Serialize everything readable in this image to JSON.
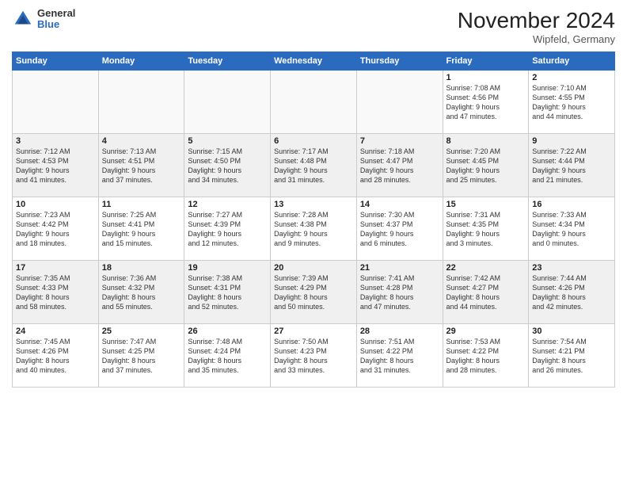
{
  "header": {
    "logo_general": "General",
    "logo_blue": "Blue",
    "title": "November 2024",
    "location": "Wipfeld, Germany"
  },
  "columns": [
    "Sunday",
    "Monday",
    "Tuesday",
    "Wednesday",
    "Thursday",
    "Friday",
    "Saturday"
  ],
  "weeks": [
    [
      {
        "day": "",
        "detail": ""
      },
      {
        "day": "",
        "detail": ""
      },
      {
        "day": "",
        "detail": ""
      },
      {
        "day": "",
        "detail": ""
      },
      {
        "day": "",
        "detail": ""
      },
      {
        "day": "1",
        "detail": "Sunrise: 7:08 AM\nSunset: 4:56 PM\nDaylight: 9 hours\nand 47 minutes."
      },
      {
        "day": "2",
        "detail": "Sunrise: 7:10 AM\nSunset: 4:55 PM\nDaylight: 9 hours\nand 44 minutes."
      }
    ],
    [
      {
        "day": "3",
        "detail": "Sunrise: 7:12 AM\nSunset: 4:53 PM\nDaylight: 9 hours\nand 41 minutes."
      },
      {
        "day": "4",
        "detail": "Sunrise: 7:13 AM\nSunset: 4:51 PM\nDaylight: 9 hours\nand 37 minutes."
      },
      {
        "day": "5",
        "detail": "Sunrise: 7:15 AM\nSunset: 4:50 PM\nDaylight: 9 hours\nand 34 minutes."
      },
      {
        "day": "6",
        "detail": "Sunrise: 7:17 AM\nSunset: 4:48 PM\nDaylight: 9 hours\nand 31 minutes."
      },
      {
        "day": "7",
        "detail": "Sunrise: 7:18 AM\nSunset: 4:47 PM\nDaylight: 9 hours\nand 28 minutes."
      },
      {
        "day": "8",
        "detail": "Sunrise: 7:20 AM\nSunset: 4:45 PM\nDaylight: 9 hours\nand 25 minutes."
      },
      {
        "day": "9",
        "detail": "Sunrise: 7:22 AM\nSunset: 4:44 PM\nDaylight: 9 hours\nand 21 minutes."
      }
    ],
    [
      {
        "day": "10",
        "detail": "Sunrise: 7:23 AM\nSunset: 4:42 PM\nDaylight: 9 hours\nand 18 minutes."
      },
      {
        "day": "11",
        "detail": "Sunrise: 7:25 AM\nSunset: 4:41 PM\nDaylight: 9 hours\nand 15 minutes."
      },
      {
        "day": "12",
        "detail": "Sunrise: 7:27 AM\nSunset: 4:39 PM\nDaylight: 9 hours\nand 12 minutes."
      },
      {
        "day": "13",
        "detail": "Sunrise: 7:28 AM\nSunset: 4:38 PM\nDaylight: 9 hours\nand 9 minutes."
      },
      {
        "day": "14",
        "detail": "Sunrise: 7:30 AM\nSunset: 4:37 PM\nDaylight: 9 hours\nand 6 minutes."
      },
      {
        "day": "15",
        "detail": "Sunrise: 7:31 AM\nSunset: 4:35 PM\nDaylight: 9 hours\nand 3 minutes."
      },
      {
        "day": "16",
        "detail": "Sunrise: 7:33 AM\nSunset: 4:34 PM\nDaylight: 9 hours\nand 0 minutes."
      }
    ],
    [
      {
        "day": "17",
        "detail": "Sunrise: 7:35 AM\nSunset: 4:33 PM\nDaylight: 8 hours\nand 58 minutes."
      },
      {
        "day": "18",
        "detail": "Sunrise: 7:36 AM\nSunset: 4:32 PM\nDaylight: 8 hours\nand 55 minutes."
      },
      {
        "day": "19",
        "detail": "Sunrise: 7:38 AM\nSunset: 4:31 PM\nDaylight: 8 hours\nand 52 minutes."
      },
      {
        "day": "20",
        "detail": "Sunrise: 7:39 AM\nSunset: 4:29 PM\nDaylight: 8 hours\nand 50 minutes."
      },
      {
        "day": "21",
        "detail": "Sunrise: 7:41 AM\nSunset: 4:28 PM\nDaylight: 8 hours\nand 47 minutes."
      },
      {
        "day": "22",
        "detail": "Sunrise: 7:42 AM\nSunset: 4:27 PM\nDaylight: 8 hours\nand 44 minutes."
      },
      {
        "day": "23",
        "detail": "Sunrise: 7:44 AM\nSunset: 4:26 PM\nDaylight: 8 hours\nand 42 minutes."
      }
    ],
    [
      {
        "day": "24",
        "detail": "Sunrise: 7:45 AM\nSunset: 4:26 PM\nDaylight: 8 hours\nand 40 minutes."
      },
      {
        "day": "25",
        "detail": "Sunrise: 7:47 AM\nSunset: 4:25 PM\nDaylight: 8 hours\nand 37 minutes."
      },
      {
        "day": "26",
        "detail": "Sunrise: 7:48 AM\nSunset: 4:24 PM\nDaylight: 8 hours\nand 35 minutes."
      },
      {
        "day": "27",
        "detail": "Sunrise: 7:50 AM\nSunset: 4:23 PM\nDaylight: 8 hours\nand 33 minutes."
      },
      {
        "day": "28",
        "detail": "Sunrise: 7:51 AM\nSunset: 4:22 PM\nDaylight: 8 hours\nand 31 minutes."
      },
      {
        "day": "29",
        "detail": "Sunrise: 7:53 AM\nSunset: 4:22 PM\nDaylight: 8 hours\nand 28 minutes."
      },
      {
        "day": "30",
        "detail": "Sunrise: 7:54 AM\nSunset: 4:21 PM\nDaylight: 8 hours\nand 26 minutes."
      }
    ]
  ]
}
